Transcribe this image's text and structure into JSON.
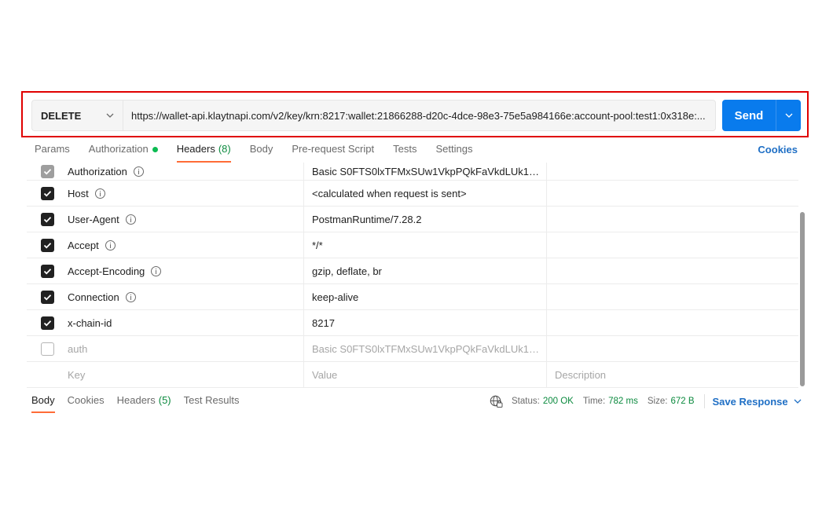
{
  "request": {
    "method": "DELETE",
    "url": "https://wallet-api.klaytnapi.com/v2/key/krn:8217:wallet:21866288-d20c-4dce-98e3-75e5a984166e:account-pool:test1:0x318e:...",
    "send_label": "Send"
  },
  "request_tabs": [
    {
      "label": "Params"
    },
    {
      "label": "Authorization"
    },
    {
      "label": "Headers",
      "count": "(8)"
    },
    {
      "label": "Body"
    },
    {
      "label": "Pre-request Script"
    },
    {
      "label": "Tests"
    },
    {
      "label": "Settings"
    }
  ],
  "cookies_label": "Cookies",
  "headers": [
    {
      "key": "Authorization",
      "value": "Basic S0FTS0lxTFMxSUw1VkpPQkFaVkdLUk1LOkl...",
      "checked": "partial"
    },
    {
      "key": "Host",
      "value": "<calculated when request is sent>",
      "checked": "true"
    },
    {
      "key": "User-Agent",
      "value": "PostmanRuntime/7.28.2",
      "checked": "true"
    },
    {
      "key": "Accept",
      "value": "*/*",
      "checked": "true"
    },
    {
      "key": "Accept-Encoding",
      "value": "gzip, deflate, br",
      "checked": "true"
    },
    {
      "key": "Connection",
      "value": "keep-alive",
      "checked": "true"
    },
    {
      "key": "x-chain-id",
      "value": "8217",
      "checked": "true"
    },
    {
      "key": "auth",
      "value": "Basic S0FTS0lxTFMxSUw1VkpPQkFaVkdLUk1LOkl...",
      "checked": "false"
    }
  ],
  "placeholders": {
    "key": "Key",
    "value": "Value",
    "description": "Description"
  },
  "response_tabs": [
    {
      "label": "Body"
    },
    {
      "label": "Cookies"
    },
    {
      "label": "Headers",
      "count": "(5)"
    },
    {
      "label": "Test Results"
    }
  ],
  "response_status": {
    "status_label": "Status:",
    "status_value": "200 OK",
    "time_label": "Time:",
    "time_value": "782 ms",
    "size_label": "Size:",
    "size_value": "672 B",
    "save_label": "Save Response"
  },
  "colors": {
    "accent": "#ff6c37",
    "send": "#097bed",
    "highlight": "#e00000",
    "success": "#0b8a3e",
    "link": "#1f6fc5"
  }
}
